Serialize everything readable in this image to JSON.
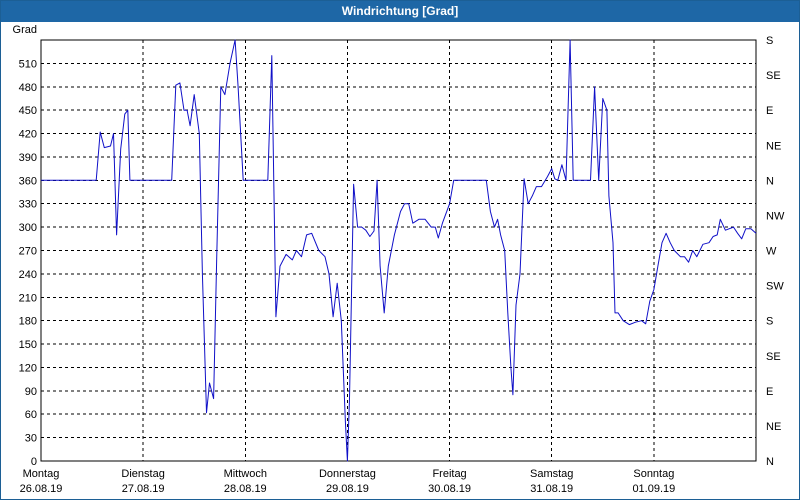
{
  "title": "Windrichtung [Grad]",
  "chart_data": {
    "type": "line",
    "title": "Windrichtung [Grad]",
    "ylabel": "Grad",
    "ylim": [
      0,
      540
    ],
    "yticks": [
      0,
      30,
      60,
      90,
      120,
      150,
      180,
      210,
      240,
      270,
      300,
      330,
      360,
      390,
      420,
      450,
      480,
      510
    ],
    "right_labels": [
      {
        "value": 0,
        "label": "N"
      },
      {
        "value": 45,
        "label": "NE"
      },
      {
        "value": 90,
        "label": "E"
      },
      {
        "value": 135,
        "label": "SE"
      },
      {
        "value": 180,
        "label": "S"
      },
      {
        "value": 225,
        "label": "SW"
      },
      {
        "value": 270,
        "label": "W"
      },
      {
        "value": 315,
        "label": "NW"
      },
      {
        "value": 360,
        "label": "N"
      },
      {
        "value": 405,
        "label": "NE"
      },
      {
        "value": 450,
        "label": "E"
      },
      {
        "value": 495,
        "label": "SE"
      },
      {
        "value": 540,
        "label": "S"
      }
    ],
    "xlim": [
      0,
      7
    ],
    "days": [
      {
        "day": "Montag",
        "date": "26.08.19"
      },
      {
        "day": "Dienstag",
        "date": "27.08.19"
      },
      {
        "day": "Mittwoch",
        "date": "28.08.19"
      },
      {
        "day": "Donnerstag",
        "date": "29.08.19"
      },
      {
        "day": "Freitag",
        "date": "30.08.19"
      },
      {
        "day": "Samstag",
        "date": "31.08.19"
      },
      {
        "day": "Sonntag",
        "date": "01.09.19"
      }
    ],
    "grid": true,
    "line_color": "#1010c8",
    "series": [
      {
        "points": [
          [
            0.0,
            360
          ],
          [
            0.2,
            360
          ],
          [
            0.4,
            360
          ],
          [
            0.54,
            360
          ],
          [
            0.58,
            422
          ],
          [
            0.62,
            402
          ],
          [
            0.68,
            404
          ],
          [
            0.71,
            420
          ],
          [
            0.74,
            290
          ],
          [
            0.78,
            400
          ],
          [
            0.82,
            445
          ],
          [
            0.85,
            450
          ],
          [
            0.87,
            360
          ],
          [
            1.0,
            360
          ],
          [
            1.2,
            360
          ],
          [
            1.28,
            360
          ],
          [
            1.32,
            482
          ],
          [
            1.36,
            485
          ],
          [
            1.4,
            450
          ],
          [
            1.43,
            450
          ],
          [
            1.46,
            430
          ],
          [
            1.5,
            470
          ],
          [
            1.55,
            420
          ],
          [
            1.58,
            240
          ],
          [
            1.62,
            62
          ],
          [
            1.65,
            100
          ],
          [
            1.69,
            80
          ],
          [
            1.72,
            260
          ],
          [
            1.76,
            480
          ],
          [
            1.8,
            470
          ],
          [
            1.85,
            510
          ],
          [
            1.9,
            540
          ],
          [
            1.93,
            480
          ],
          [
            1.98,
            360
          ],
          [
            2.1,
            360
          ],
          [
            2.22,
            360
          ],
          [
            2.26,
            520
          ],
          [
            2.3,
            185
          ],
          [
            2.34,
            250
          ],
          [
            2.4,
            265
          ],
          [
            2.46,
            258
          ],
          [
            2.5,
            270
          ],
          [
            2.55,
            262
          ],
          [
            2.6,
            290
          ],
          [
            2.65,
            292
          ],
          [
            2.72,
            270
          ],
          [
            2.78,
            262
          ],
          [
            2.82,
            240
          ],
          [
            2.86,
            185
          ],
          [
            2.9,
            228
          ],
          [
            2.94,
            180
          ],
          [
            2.98,
            50
          ],
          [
            3.0,
            0
          ],
          [
            3.02,
            80
          ],
          [
            3.06,
            355
          ],
          [
            3.1,
            300
          ],
          [
            3.14,
            300
          ],
          [
            3.18,
            296
          ],
          [
            3.22,
            288
          ],
          [
            3.26,
            295
          ],
          [
            3.29,
            360
          ],
          [
            3.32,
            250
          ],
          [
            3.36,
            190
          ],
          [
            3.4,
            250
          ],
          [
            3.46,
            290
          ],
          [
            3.52,
            320
          ],
          [
            3.56,
            330
          ],
          [
            3.6,
            330
          ],
          [
            3.64,
            305
          ],
          [
            3.7,
            310
          ],
          [
            3.76,
            310
          ],
          [
            3.82,
            300
          ],
          [
            3.86,
            300
          ],
          [
            3.89,
            286
          ],
          [
            3.93,
            305
          ],
          [
            4.0,
            330
          ],
          [
            4.04,
            360
          ],
          [
            4.1,
            360
          ],
          [
            4.2,
            360
          ],
          [
            4.3,
            360
          ],
          [
            4.36,
            360
          ],
          [
            4.4,
            320
          ],
          [
            4.44,
            300
          ],
          [
            4.47,
            310
          ],
          [
            4.5,
            290
          ],
          [
            4.54,
            270
          ],
          [
            4.57,
            190
          ],
          [
            4.6,
            120
          ],
          [
            4.62,
            85
          ],
          [
            4.65,
            200
          ],
          [
            4.69,
            240
          ],
          [
            4.73,
            362
          ],
          [
            4.77,
            330
          ],
          [
            4.81,
            340
          ],
          [
            4.85,
            352
          ],
          [
            4.9,
            352
          ],
          [
            4.96,
            365
          ],
          [
            5.0,
            375
          ],
          [
            5.03,
            362
          ],
          [
            5.06,
            360
          ],
          [
            5.1,
            380
          ],
          [
            5.14,
            360
          ],
          [
            5.18,
            540
          ],
          [
            5.21,
            360
          ],
          [
            5.26,
            360
          ],
          [
            5.32,
            360
          ],
          [
            5.38,
            360
          ],
          [
            5.42,
            480
          ],
          [
            5.46,
            360
          ],
          [
            5.5,
            465
          ],
          [
            5.54,
            450
          ],
          [
            5.56,
            340
          ],
          [
            5.6,
            280
          ],
          [
            5.62,
            190
          ],
          [
            5.65,
            190
          ],
          [
            5.7,
            180
          ],
          [
            5.76,
            175
          ],
          [
            5.82,
            178
          ],
          [
            5.88,
            180
          ],
          [
            5.92,
            176
          ],
          [
            5.96,
            205
          ],
          [
            6.0,
            220
          ],
          [
            6.04,
            250
          ],
          [
            6.08,
            280
          ],
          [
            6.12,
            292
          ],
          [
            6.16,
            280
          ],
          [
            6.2,
            270
          ],
          [
            6.26,
            262
          ],
          [
            6.3,
            262
          ],
          [
            6.34,
            255
          ],
          [
            6.38,
            270
          ],
          [
            6.42,
            262
          ],
          [
            6.48,
            278
          ],
          [
            6.54,
            280
          ],
          [
            6.58,
            288
          ],
          [
            6.62,
            290
          ],
          [
            6.65,
            310
          ],
          [
            6.7,
            296
          ],
          [
            6.78,
            300
          ],
          [
            6.82,
            292
          ],
          [
            6.86,
            285
          ],
          [
            6.9,
            298
          ],
          [
            6.95,
            298
          ],
          [
            7.0,
            292
          ]
        ]
      }
    ]
  }
}
